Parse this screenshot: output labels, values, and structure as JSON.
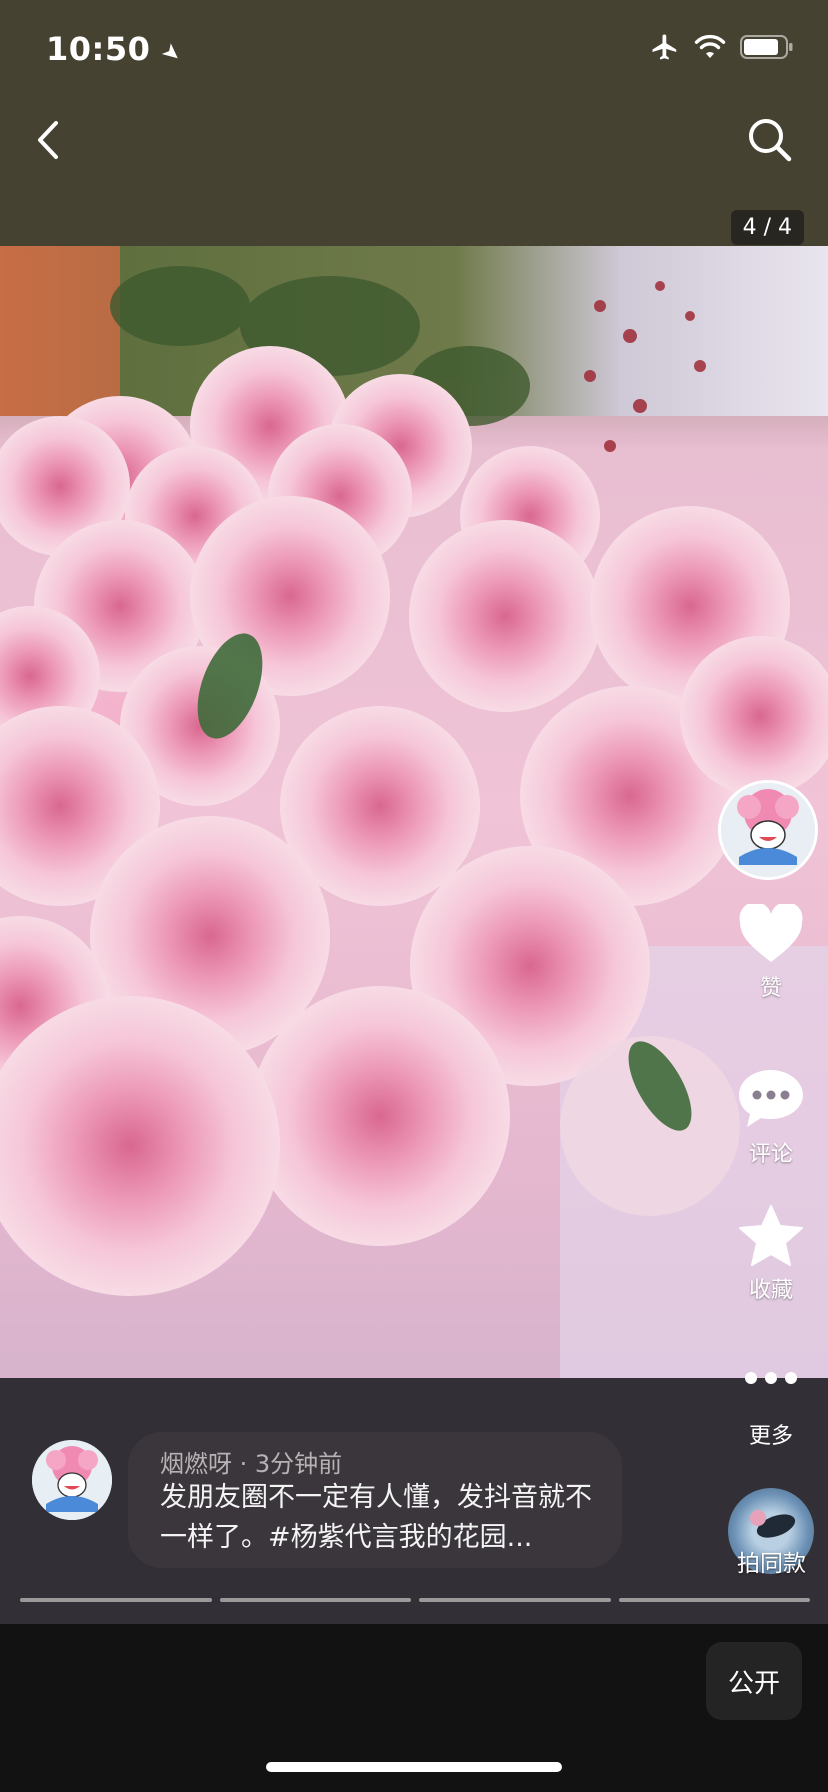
{
  "status_bar": {
    "time": "10:50"
  },
  "header": {
    "page_counter": "4 / 4"
  },
  "actions": {
    "like_label": "赞",
    "comment_label": "评论",
    "favorite_label": "收藏",
    "more_label": "更多",
    "same_style_label": "拍同款"
  },
  "post": {
    "author": "烟燃呀",
    "separator": " · ",
    "time_ago": "3分钟前",
    "caption": "发朋友圈不一定有人懂，发抖音就不一样了。#杨紫代言我的花园..."
  },
  "footer": {
    "visibility_label": "公开"
  },
  "gallery": {
    "total": 4,
    "current": 4
  },
  "colors": {
    "header_bg": "#464232",
    "page_bg": "#121212",
    "bubble_bg": "#3a363c"
  }
}
